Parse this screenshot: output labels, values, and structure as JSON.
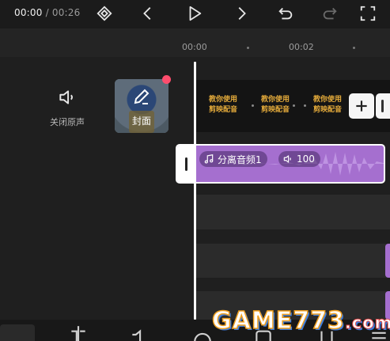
{
  "topbar": {
    "current_time": "00:00",
    "separator": " / ",
    "total_time": "00:26",
    "icons": [
      "keyframe-icon",
      "prev-icon",
      "play-icon",
      "next-icon",
      "undo-icon",
      "redo-icon",
      "fullscreen-icon"
    ]
  },
  "ruler": {
    "ticks": [
      "00:00",
      "00:02"
    ]
  },
  "track_panel": {
    "mute_label": "关闭原声",
    "cover_label": "封面"
  },
  "video_track": {
    "frames": [
      {
        "line1": "教你使用",
        "line2": "剪映配音"
      },
      {
        "line1": "教你使用",
        "line2": "剪映配音"
      },
      {
        "line1": "教你使用",
        "line2": "剪映配音"
      }
    ]
  },
  "audio_clip": {
    "name": "分离音频1",
    "volume": "100"
  },
  "watermark": {
    "text": "GAME773",
    "suffix": ".com"
  },
  "colors": {
    "accent_purple": "#a56fcf",
    "badge_red": "#ff4d6d",
    "background": "#1f1f1f"
  }
}
